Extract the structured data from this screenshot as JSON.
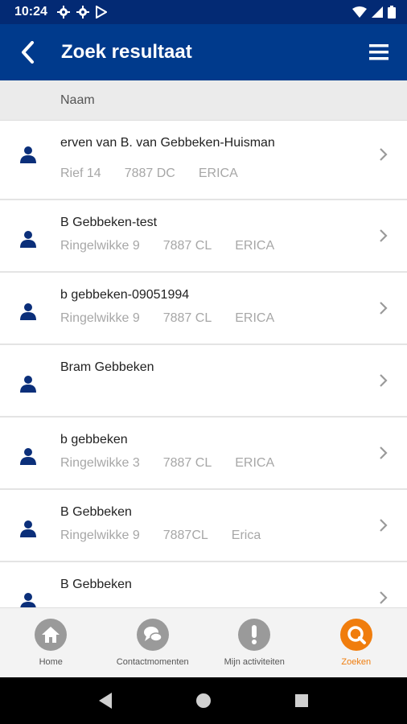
{
  "status_bar": {
    "time": "10:24",
    "icons_left": [
      "gear-icon",
      "gear-icon",
      "play-store-icon"
    ],
    "icons_right": [
      "wifi-icon",
      "signal-icon",
      "battery-icon"
    ],
    "background": "#032a74"
  },
  "app_bar": {
    "title": "Zoek resultaat",
    "back_icon": "chevron-left-icon",
    "menu_icon": "hamburger-menu-icon",
    "background": "#003a8c"
  },
  "column_header": {
    "label": "Naam"
  },
  "results": [
    {
      "name": "erven van B. van Gebbeken-Huisman",
      "street": "Rief 14",
      "postcode": "7887 DC",
      "city": "ERICA"
    },
    {
      "name": "B Gebbeken-test",
      "street": "Ringelwikke 9",
      "postcode": "7887 CL",
      "city": "ERICA"
    },
    {
      "name": "b gebbeken-09051994",
      "street": "Ringelwikke 9",
      "postcode": "7887 CL",
      "city": "ERICA"
    },
    {
      "name": "Bram Gebbeken",
      "street": "",
      "postcode": "",
      "city": ""
    },
    {
      "name": "b gebbeken",
      "street": "Ringelwikke 3",
      "postcode": "7887 CL",
      "city": "ERICA"
    },
    {
      "name": "B Gebbeken",
      "street": "Ringelwikke 9",
      "postcode": "7887CL",
      "city": "Erica"
    },
    {
      "name": "B Gebbeken",
      "street": "",
      "postcode": "",
      "city": ""
    }
  ],
  "bottom_nav": [
    {
      "label": "Home",
      "icon": "home-icon",
      "active": false
    },
    {
      "label": "Contactmomenten",
      "icon": "chat-bubbles-icon",
      "active": false
    },
    {
      "label": "Mijn activiteiten",
      "icon": "exclamation-icon",
      "active": false
    },
    {
      "label": "Zoeken",
      "icon": "search-icon",
      "active": true
    }
  ],
  "system_nav": [
    "back-triangle-icon",
    "home-circle-icon",
    "recents-square-icon"
  ],
  "colors": {
    "accent": "#f07d0d",
    "primary": "#003a8c",
    "person_icon": "#0b2f7a",
    "muted_text": "#a7a7a7"
  }
}
